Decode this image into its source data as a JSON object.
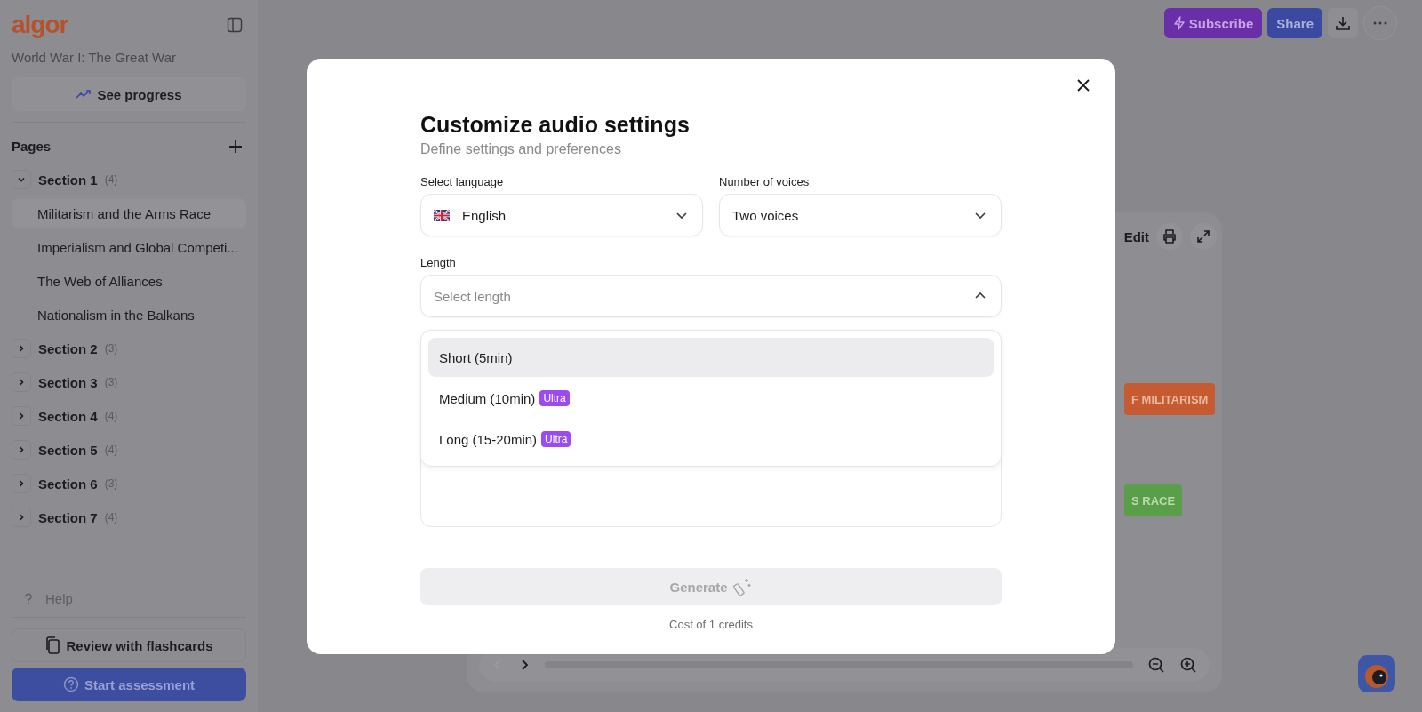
{
  "sidebar": {
    "logo": "algor",
    "course_title": "World War I: The Great War",
    "progress_button": "See progress",
    "pages_heading": "Pages",
    "sections": [
      {
        "title": "Section 1",
        "count": "(4)",
        "expanded": true,
        "children": [
          {
            "label": "Militarism and the Arms Race",
            "selected": true
          },
          {
            "label": "Imperialism and Global Competi...",
            "selected": false
          },
          {
            "label": "The Web of Alliances",
            "selected": false
          },
          {
            "label": "Nationalism in the Balkans",
            "selected": false
          }
        ]
      },
      {
        "title": "Section 2",
        "count": "(3)",
        "expanded": false
      },
      {
        "title": "Section 3",
        "count": "(3)",
        "expanded": false
      },
      {
        "title": "Section 4",
        "count": "(4)",
        "expanded": false
      },
      {
        "title": "Section 5",
        "count": "(4)",
        "expanded": false
      },
      {
        "title": "Section 6",
        "count": "(3)",
        "expanded": false
      },
      {
        "title": "Section 7",
        "count": "(4)",
        "expanded": false
      }
    ],
    "help": "Help",
    "flashcards_button": "Review with flashcards",
    "assessment_button": "Start assessment"
  },
  "header": {
    "buttons": [
      {
        "kind": "subscribe",
        "label": "Subscribe"
      },
      {
        "kind": "share",
        "label": "Share"
      },
      {
        "kind": "download"
      },
      {
        "kind": "more"
      }
    ]
  },
  "viewer": {
    "toolbar_label": "Edit",
    "nodes": [
      {
        "label": "F MILITARISM",
        "color": "#c65a30"
      },
      {
        "label": "S RACE",
        "color": "#5a9e4a"
      }
    ],
    "prev_disabled": true
  },
  "modal": {
    "title": "Customize audio settings",
    "subtitle": "Define settings and preferences",
    "fields": [
      {
        "kind": "language",
        "label": "Select language",
        "value": "English"
      },
      {
        "kind": "plain",
        "label": "Number of voices",
        "value": "Two voices"
      }
    ],
    "length": {
      "label": "Length",
      "placeholder": "Select length",
      "expanded": true,
      "options": [
        {
          "label": "Short (5min)",
          "selected": true
        },
        {
          "label": "Medium (10min)",
          "badge": "Ultra",
          "selected": false
        },
        {
          "label": "Long (15-20min)",
          "badge": "Ultra",
          "selected": false
        }
      ]
    },
    "generate_button": {
      "label": "Generate",
      "disabled": true
    },
    "cost": "Cost of 1 credits"
  }
}
